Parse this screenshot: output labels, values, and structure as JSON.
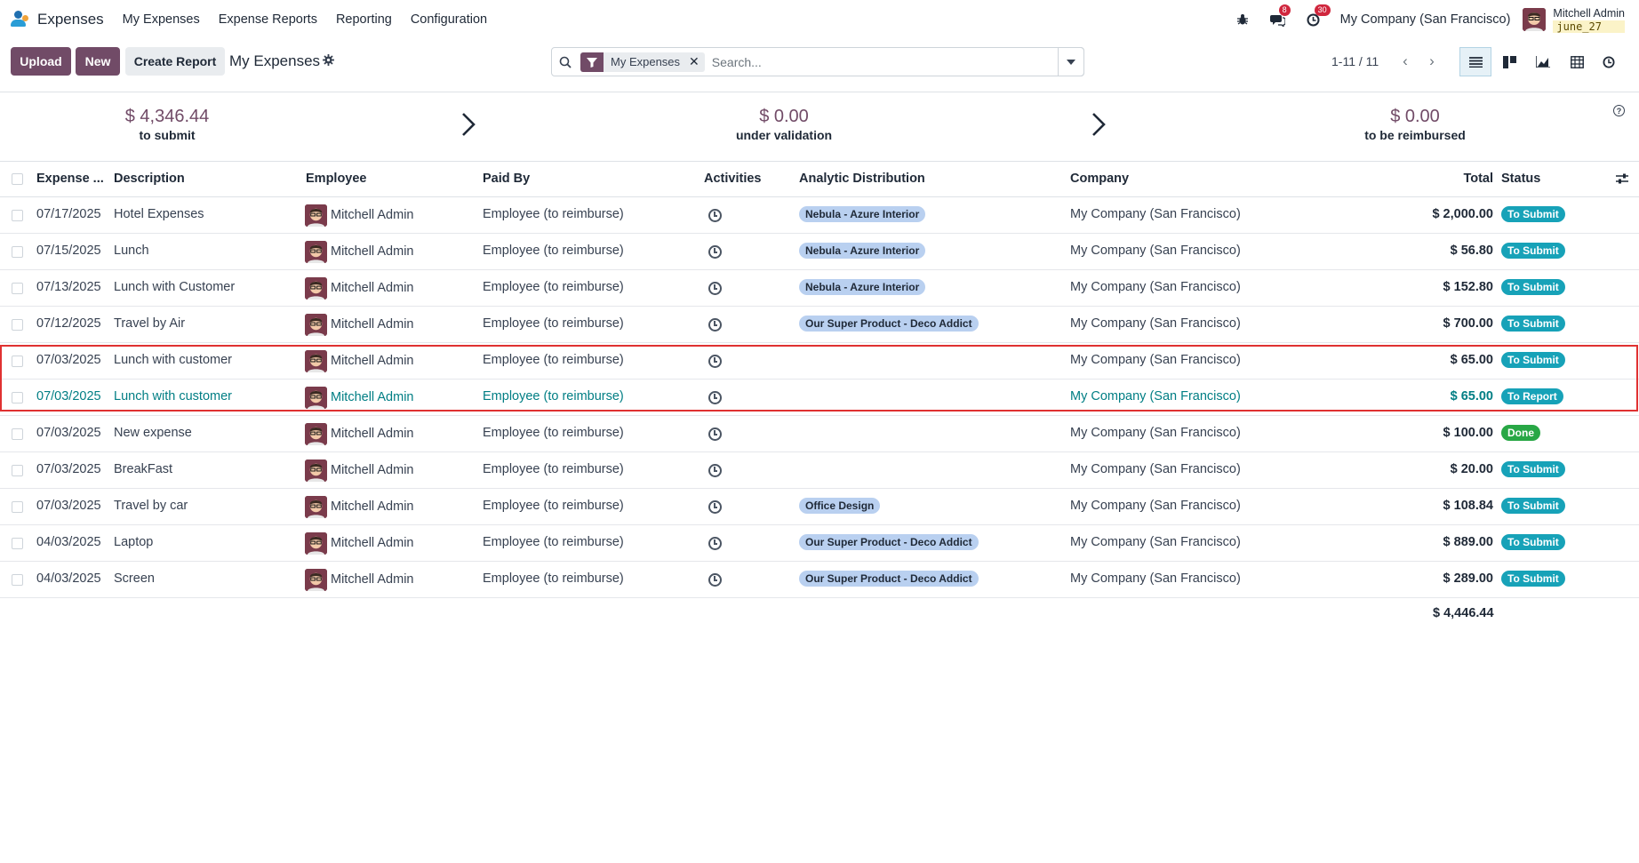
{
  "navbar": {
    "app_name": "Expenses",
    "menu": [
      "My Expenses",
      "Expense Reports",
      "Reporting",
      "Configuration"
    ],
    "messages_badge": "8",
    "activities_badge": "30",
    "company": "My Company (San Francisco)",
    "user_name": "Mitchell Admin",
    "user_db": "june_27"
  },
  "control": {
    "upload_label": "Upload",
    "new_label": "New",
    "create_report_label": "Create Report",
    "title": "My Expenses",
    "facet_label": "My Expenses",
    "search_placeholder": "Search...",
    "pager": "1-11 / 11"
  },
  "stats": {
    "to_submit_value": "$ 4,346.44",
    "to_submit_label": "to submit",
    "under_validation_value": "$ 0.00",
    "under_validation_label": "under validation",
    "to_be_reimbursed_value": "$ 0.00",
    "to_be_reimbursed_label": "to be reimbursed"
  },
  "table": {
    "headers": {
      "date": "Expense ...",
      "description": "Description",
      "employee": "Employee",
      "paid_by": "Paid By",
      "activities": "Activities",
      "analytic": "Analytic Distribution",
      "company": "Company",
      "total": "Total",
      "status": "Status"
    },
    "rows": [
      {
        "date": "07/17/2025",
        "description": "Hotel Expenses",
        "employee": "Mitchell Admin",
        "paid_by": "Employee (to reimburse)",
        "analytic": "Nebula - Azure Interior",
        "company": "My Company (San Francisco)",
        "total": "$ 2,000.00",
        "status": "To Submit"
      },
      {
        "date": "07/15/2025",
        "description": "Lunch",
        "employee": "Mitchell Admin",
        "paid_by": "Employee (to reimburse)",
        "analytic": "Nebula - Azure Interior",
        "company": "My Company (San Francisco)",
        "total": "$ 56.80",
        "status": "To Submit"
      },
      {
        "date": "07/13/2025",
        "description": "Lunch with Customer",
        "employee": "Mitchell Admin",
        "paid_by": "Employee (to reimburse)",
        "analytic": "Nebula - Azure Interior",
        "company": "My Company (San Francisco)",
        "total": "$ 152.80",
        "status": "To Submit"
      },
      {
        "date": "07/12/2025",
        "description": "Travel by Air",
        "employee": "Mitchell Admin",
        "paid_by": "Employee (to reimburse)",
        "analytic": "Our Super Product - Deco Addict",
        "company": "My Company (San Francisco)",
        "total": "$ 700.00",
        "status": "To Submit"
      },
      {
        "date": "07/03/2025",
        "description": "Lunch with customer",
        "employee": "Mitchell Admin",
        "paid_by": "Employee (to reimburse)",
        "analytic": "",
        "company": "My Company (San Francisco)",
        "total": "$ 65.00",
        "status": "To Submit"
      },
      {
        "date": "07/03/2025",
        "description": "Lunch with customer",
        "employee": "Mitchell Admin",
        "paid_by": "Employee (to reimburse)",
        "analytic": "",
        "company": "My Company (San Francisco)",
        "total": "$ 65.00",
        "status": "To Report"
      },
      {
        "date": "07/03/2025",
        "description": "New expense",
        "employee": "Mitchell Admin",
        "paid_by": "Employee (to reimburse)",
        "analytic": "",
        "company": "My Company (San Francisco)",
        "total": "$ 100.00",
        "status": "Done"
      },
      {
        "date": "07/03/2025",
        "description": "BreakFast",
        "employee": "Mitchell Admin",
        "paid_by": "Employee (to reimburse)",
        "analytic": "",
        "company": "My Company (San Francisco)",
        "total": "$ 20.00",
        "status": "To Submit"
      },
      {
        "date": "07/03/2025",
        "description": "Travel by car",
        "employee": "Mitchell Admin",
        "paid_by": "Employee (to reimburse)",
        "analytic": "Office Design",
        "company": "My Company (San Francisco)",
        "total": "$ 108.84",
        "status": "To Submit"
      },
      {
        "date": "04/03/2025",
        "description": "Laptop",
        "employee": "Mitchell Admin",
        "paid_by": "Employee (to reimburse)",
        "analytic": "Our Super Product - Deco Addict",
        "company": "My Company (San Francisco)",
        "total": "$ 889.00",
        "status": "To Submit"
      },
      {
        "date": "04/03/2025",
        "description": "Screen",
        "employee": "Mitchell Admin",
        "paid_by": "Employee (to reimburse)",
        "analytic": "Our Super Product - Deco Addict",
        "company": "My Company (San Francisco)",
        "total": "$ 289.00",
        "status": "To Submit"
      }
    ],
    "grand_total": "$ 4,446.44"
  },
  "colors": {
    "primary": "#714b67",
    "to_submit": "#17a2b8",
    "to_report": "#17a2b8",
    "done": "#28a745",
    "tag_bg": "#b9d0f0",
    "link": "#017e84",
    "highlight": "#e03131"
  },
  "icons": [
    "search-icon",
    "filter-icon",
    "close-icon",
    "caret-down-icon",
    "bug-icon",
    "chat-icon",
    "clock-icon",
    "gear-icon",
    "chevron-left-icon",
    "chevron-right-icon",
    "list-view-icon",
    "kanban-view-icon",
    "graph-view-icon",
    "pivot-view-icon",
    "activity-view-icon",
    "help-icon",
    "optional-columns-icon"
  ]
}
